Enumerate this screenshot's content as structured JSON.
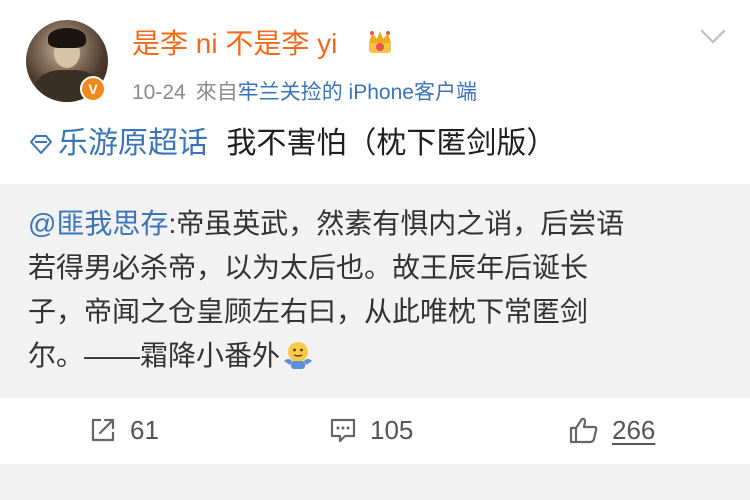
{
  "user": {
    "name": "是李 ni 不是李 yi",
    "verified_badge": "V"
  },
  "meta": {
    "date": "10-24",
    "from_label": "來自",
    "source": "牢兰关捡的 iPhone客户端"
  },
  "post": {
    "super_topic": "乐游原超话",
    "text": "我不害怕（枕下匿剑版）"
  },
  "repost": {
    "mention": "@匪我思存",
    "line1": ":帝虽英武，然素有惧内之诮，后尝语",
    "line2": "若得男必杀帝，以为太后也。故王辰年后诞长",
    "line3": "子，帝闻之仓皇顾左右曰，从此唯枕下常匿剑",
    "line4": "尔。——霜降小番外"
  },
  "actions": {
    "reposts": "61",
    "comments": "105",
    "likes": "266"
  },
  "colors": {
    "username": "#f26b1d",
    "link": "#3b74b8",
    "repost_bg": "#f2f2f2",
    "badge": "#f08a1c"
  },
  "icons": [
    "crown-icon",
    "chevron-down-icon",
    "diamond-icon",
    "emoji-shrug-icon",
    "repost-icon",
    "comment-icon",
    "like-icon"
  ]
}
